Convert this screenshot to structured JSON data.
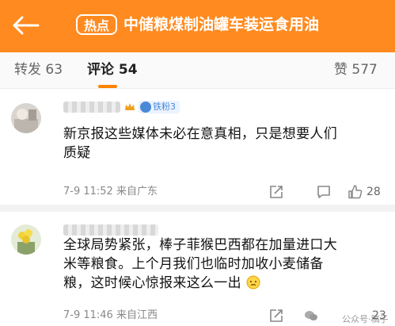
{
  "header": {
    "hot_label": "热点",
    "title": "中储粮煤制油罐车装运食用油",
    "background": "#ff8a1f"
  },
  "tabs": {
    "repost_label": "转发",
    "repost_count": "63",
    "comment_label": "评论",
    "comment_count": "54",
    "like_label": "赞",
    "like_count": "577",
    "accent": "#ff8200"
  },
  "comments": [
    {
      "fan_badge": "铁粉3",
      "text_line1": "新京报这些媒体未必在意真相，只是想要人们",
      "text_line2": "质疑",
      "time": "7-9 11:52",
      "location": "来自广东",
      "like_count": "28"
    },
    {
      "text_line1": "全球局势紧张，棒子菲猴巴西都在加量进口大",
      "text_line2": "米等粮食。上个月我们也临时加收小麦储备",
      "text_line3": "粮，这时候心惊报来这么一出",
      "time": "7-9 11:46",
      "location": "来自江西",
      "like_count": "23"
    }
  ],
  "icons": {
    "back": "back-arrow-icon",
    "share": "share-icon",
    "comment": "comment-icon",
    "like": "thumbs-up-icon",
    "crown": "crown-icon",
    "emoji": "embarrassed-emoji-icon"
  },
  "watermark": "公众号·稿子"
}
